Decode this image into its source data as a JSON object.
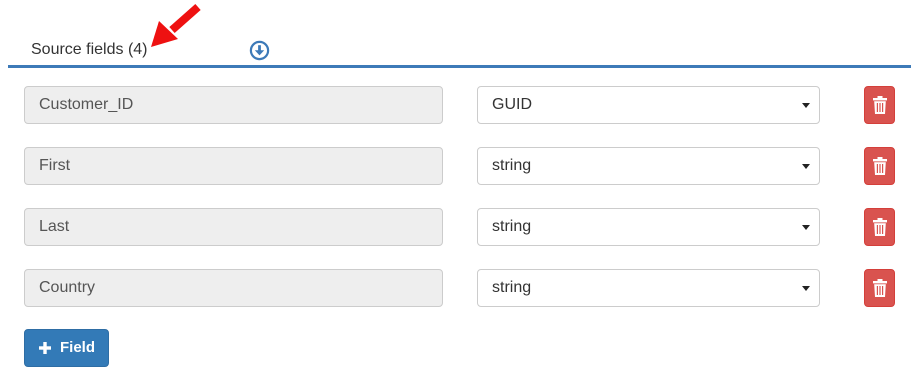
{
  "header": {
    "title": "Source fields (4)",
    "download_icon": "arrow-circle-down-icon",
    "annotation_icon": "red-arrow-icon"
  },
  "fields": [
    {
      "name": "Customer_ID",
      "type": "GUID"
    },
    {
      "name": "First",
      "type": "string"
    },
    {
      "name": "Last",
      "type": "string"
    },
    {
      "name": "Country",
      "type": "string"
    }
  ],
  "delete_icon": "trash-icon",
  "add_button": {
    "label": "Field",
    "icon": "plus-icon"
  },
  "colors": {
    "accent": "#3d7ab8",
    "primary_button": "#337ab7",
    "danger_button": "#d9534f",
    "readonly_input_bg": "#eeeeee",
    "annotation_arrow": "#ee1111"
  }
}
